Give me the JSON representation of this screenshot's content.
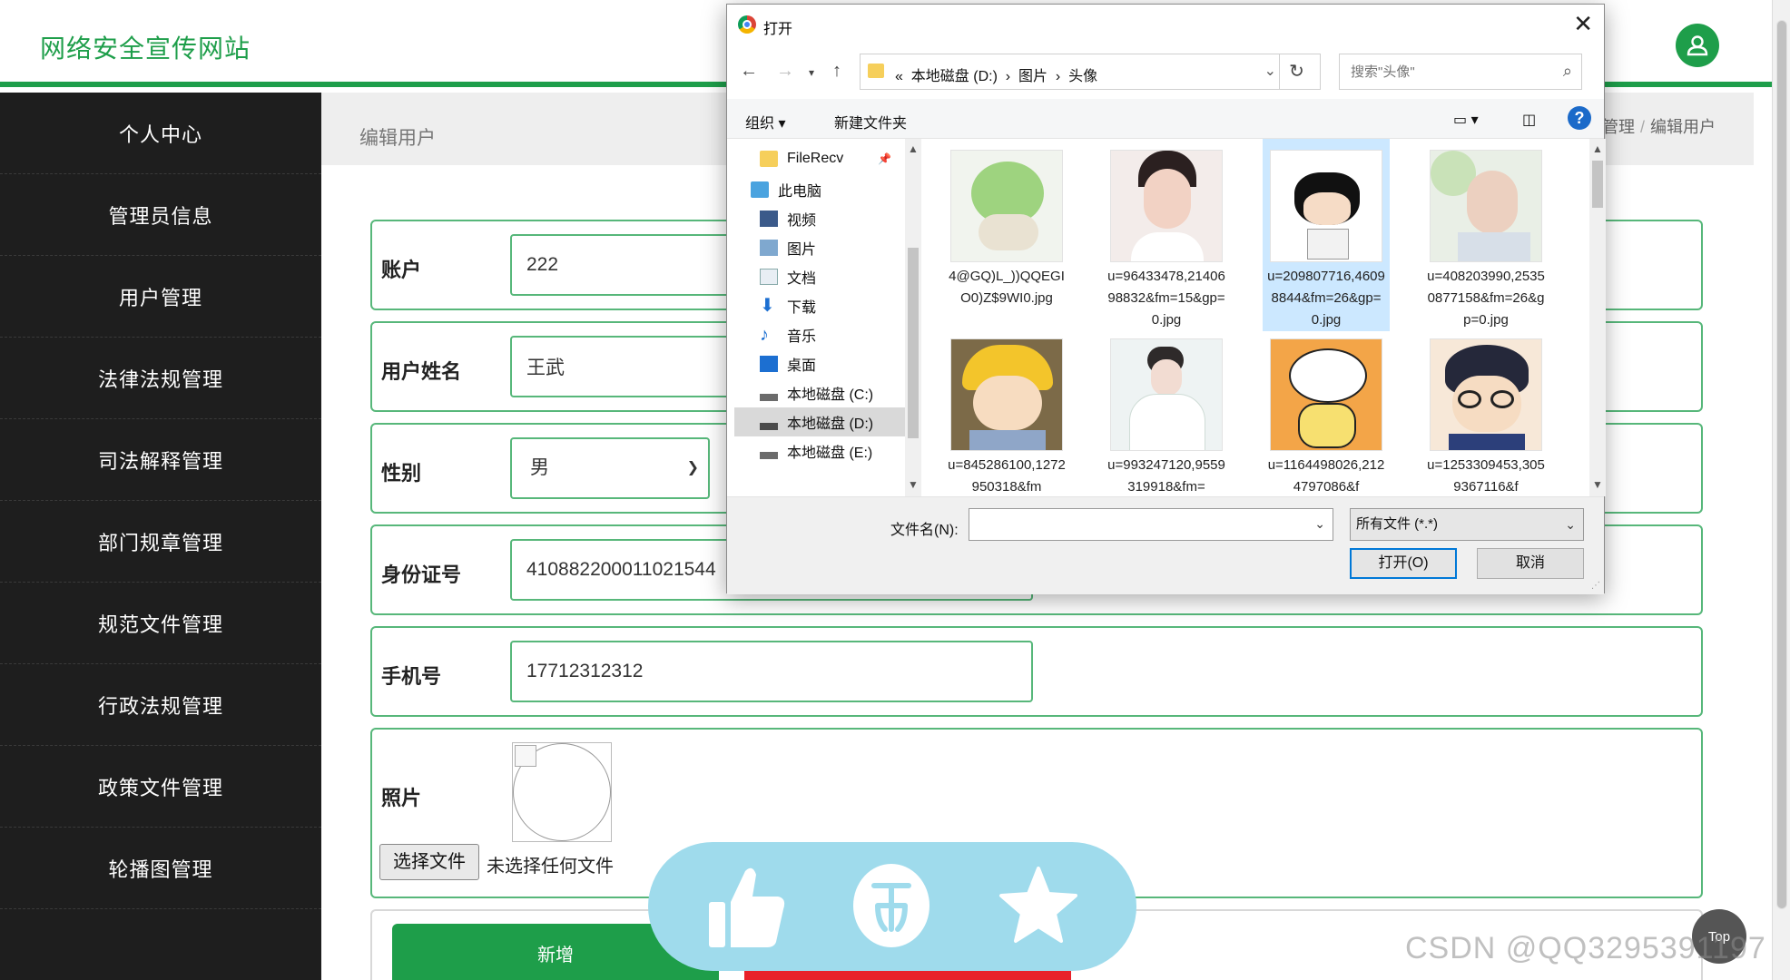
{
  "site": {
    "title": "网络安全宣传网站"
  },
  "sidebar": {
    "items": [
      {
        "label": "个人中心"
      },
      {
        "label": "管理员信息"
      },
      {
        "label": "用户管理"
      },
      {
        "label": "法律法规管理"
      },
      {
        "label": "司法解释管理"
      },
      {
        "label": "部门规章管理"
      },
      {
        "label": "规范文件管理"
      },
      {
        "label": "行政法规管理"
      },
      {
        "label": "政策文件管理"
      },
      {
        "label": "轮播图管理"
      }
    ]
  },
  "breadcrumb": {
    "title": "编辑用户",
    "parent": "管理",
    "current": "编辑用户",
    "separator": "/"
  },
  "form": {
    "account": {
      "label": "账户",
      "value": "222"
    },
    "name": {
      "label": "用户姓名",
      "value": "王武"
    },
    "gender": {
      "label": "性别",
      "value": "男"
    },
    "id_card": {
      "label": "身份证号",
      "value": "410882200011021544"
    },
    "phone": {
      "label": "手机号",
      "value": "17712312312"
    },
    "photo": {
      "label": "照片",
      "file_button": "选择文件",
      "file_status": "未选择任何文件"
    },
    "add_button": "新增"
  },
  "float_bar": {
    "icons": [
      "thumb-up-icon",
      "coin-icon",
      "star-icon"
    ]
  },
  "top_button": {
    "label": "Top"
  },
  "watermark": "CSDN @QQ3295391197",
  "dialog": {
    "title": "打开",
    "close_glyph": "✕",
    "address": {
      "prefix": "«",
      "parts": [
        "本地磁盘 (D:)",
        "图片",
        "头像"
      ],
      "sep": "›"
    },
    "search_placeholder": "搜索\"头像\"",
    "commands": {
      "organize": "组织 ▾",
      "new_folder": "新建文件夹",
      "help": "?"
    },
    "nav": [
      {
        "label": "FileRecv",
        "icon": "folder-icon"
      },
      {
        "label": "此电脑",
        "icon": "computer-icon"
      },
      {
        "label": "视频",
        "icon": "video-icon"
      },
      {
        "label": "图片",
        "icon": "picture-icon"
      },
      {
        "label": "文档",
        "icon": "document-icon"
      },
      {
        "label": "下载",
        "icon": "download-icon"
      },
      {
        "label": "音乐",
        "icon": "music-icon"
      },
      {
        "label": "桌面",
        "icon": "desktop-icon"
      },
      {
        "label": "本地磁盘 (C:)",
        "icon": "drive-icon"
      },
      {
        "label": "本地磁盘 (D:)",
        "icon": "drive-icon",
        "selected": true
      },
      {
        "label": "本地磁盘 (E:)",
        "icon": "drive-icon"
      }
    ],
    "files": [
      {
        "name": "4@GQ)L_))QQEGIO0)Z$9WI0.jpg",
        "thumb": "cabbage-dog"
      },
      {
        "name": "u=96433478,2140698832&fm=15&gp=0.jpg",
        "thumb": "woman-portrait"
      },
      {
        "name": "u=209807716,46098844&fm=26&gp=0.jpg",
        "thumb": "cartoon-boy",
        "selected": true
      },
      {
        "name": "u=408203990,25350877158&fm=26&gp=0.jpg",
        "thumb": "man-flowers"
      },
      {
        "name": "u=845286100,1272950318&fm",
        "thumb": "cartoon-yellow-hat"
      },
      {
        "name": "u=993247120,9559319918&fm=",
        "thumb": "woman-white"
      },
      {
        "name": "u=1164498026,2124797086&f",
        "thumb": "cartoon-orange"
      },
      {
        "name": "u=1253309453,3059367116&f",
        "thumb": "cartoon-glasses"
      }
    ],
    "filename_label": "文件名(N):",
    "filename_value": "",
    "filetype": "所有文件 (*.*)",
    "open_button": "打开(O)",
    "cancel_button": "取消"
  },
  "colors": {
    "brand": "#1e9e4a",
    "sidebar": "#1e1e1e",
    "danger": "#e8222a",
    "float": "#9fdbec",
    "dialog_selection": "#cce8ff"
  }
}
